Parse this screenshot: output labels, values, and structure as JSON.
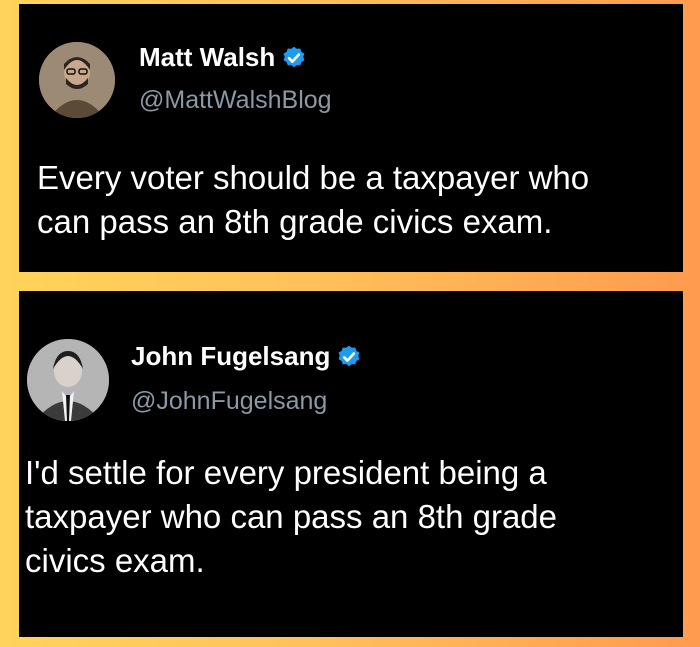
{
  "tweets": [
    {
      "name": "Matt Walsh",
      "handle": "@MattWalshBlog",
      "text": "Every voter should be a taxpayer who\ncan pass an 8th grade civics exam.",
      "verified_icon": "verified-badge-icon"
    },
    {
      "name": "John Fugelsang",
      "handle": "@JohnFugelsang",
      "text": "I'd settle for every president being a\ntaxpayer who can pass an 8th grade\ncivics exam.",
      "verified_icon": "verified-badge-icon"
    }
  ],
  "colors": {
    "card_background": "#000000",
    "handle_color": "#8b98a5",
    "verified_color": "#1d9bf0",
    "page_background_start": "#ffd45a",
    "page_background_end": "#ff9a4e"
  }
}
